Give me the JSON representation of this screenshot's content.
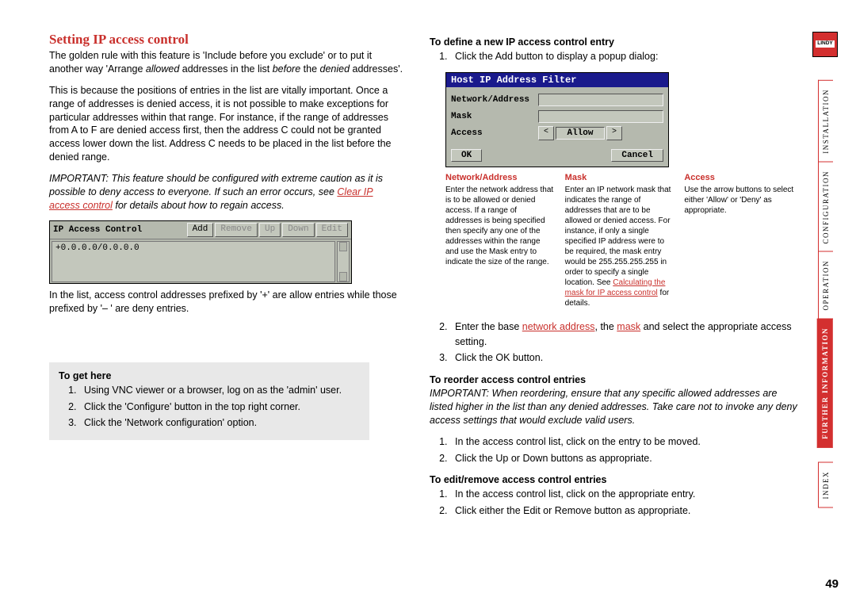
{
  "brand": "LINDY",
  "page_number": "49",
  "nav": {
    "items": [
      "INSTALLATION",
      "CONFIGURATION",
      "OPERATION",
      "FURTHER INFORMATION",
      "INDEX"
    ],
    "active_index": 3
  },
  "left": {
    "title": "Setting IP access control",
    "para1_a": "The golden rule with this feature is 'Include before you exclude' or to put it another way 'Arrange ",
    "para1_b": "allowed",
    "para1_c": " addresses in the list ",
    "para1_d": "before",
    "para1_e": " the ",
    "para1_f": "denied",
    "para1_g": " addresses'.",
    "para2": "This is because the positions of entries in the list are vitally important. Once a range of addresses is denied access, it is not possible to make exceptions for particular addresses within that range. For instance, if the range of addresses from A to F are denied access first, then the address C could not be granted access lower down the list. Address C needs to be placed in the list before the denied range.",
    "important_a": "IMPORTANT: This feature should be configured with extreme caution as it is possible to deny access to everyone. If such an error occurs, see ",
    "important_link": "Clear IP access control",
    "important_b": " for details about how to regain access.",
    "listbox": {
      "title": "IP Access Control",
      "buttons": [
        "Add",
        "Remove",
        "Up",
        "Down",
        "Edit"
      ],
      "entry": "+0.0.0.0/0.0.0.0"
    },
    "para3": "In the list, access control addresses prefixed by '+' are allow entries while those prefixed by '– ' are deny entries.",
    "get_here": {
      "title": "To get here",
      "steps": [
        "Using VNC viewer or a browser, log on as the 'admin' user.",
        "Click the 'Configure' button in the top right corner.",
        "Click the 'Network configuration' option."
      ]
    }
  },
  "right": {
    "define": {
      "title": "To define a new IP access control entry",
      "step1": "Click the Add button to display a popup dialog:"
    },
    "dialog": {
      "title": "Host IP Address Filter",
      "row1": "Network/Address",
      "row2": "Mask",
      "row3": "Access",
      "selector_value": "Allow",
      "ok": "OK",
      "cancel": "Cancel"
    },
    "desc": {
      "col1_title": "Network/Address",
      "col1_text": "Enter the network address that is to be allowed or denied access. If a range of addresses is being specified then specify any one of the addresses within the range and use the Mask entry to indicate the size of the range.",
      "col2_title": "Mask",
      "col2_text_a": "Enter an IP network mask that indicates the range of addresses that are to be allowed or denied access. For instance, if only a single specified IP address were to be required, the mask entry would be 255.255.255.255 in order to specify a single location. See ",
      "col2_link": "Calculating the mask for IP access control",
      "col2_text_b": " for details.",
      "col3_title": "Access",
      "col3_text": "Use the arrow buttons to select either 'Allow' or 'Deny' as appropriate."
    },
    "step2_a": "Enter the base ",
    "step2_link1": "network address",
    "step2_b": ", the ",
    "step2_link2": "mask",
    "step2_c": " and select the appropriate access setting.",
    "step3": "Click the OK button.",
    "reorder": {
      "title": "To reorder access control entries",
      "note": "IMPORTANT: When reordering, ensure that any specific allowed addresses are listed higher in the list than any denied addresses. Take care not to invoke any deny access settings that would exclude valid users.",
      "steps": [
        "In the access control list, click on the entry to be moved.",
        "Click the Up or Down buttons as appropriate."
      ]
    },
    "edit": {
      "title": "To edit/remove access control entries",
      "steps": [
        "In the access control list, click on the appropriate entry.",
        "Click either the Edit or Remove button as appropriate."
      ]
    }
  }
}
